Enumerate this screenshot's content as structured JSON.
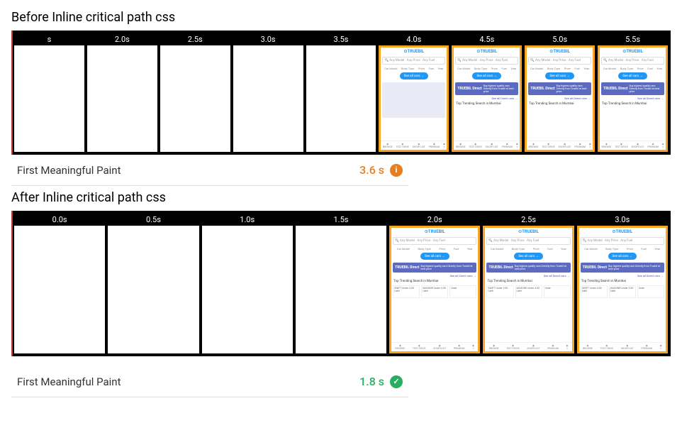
{
  "before": {
    "title": "Before Inline critical path css",
    "frames": [
      {
        "time": "s",
        "state": "blank"
      },
      {
        "time": "2.0s",
        "state": "blank"
      },
      {
        "time": "2.5s",
        "state": "blank"
      },
      {
        "time": "3.0s",
        "state": "blank"
      },
      {
        "time": "3.5s",
        "state": "blank"
      },
      {
        "time": "4.0s",
        "state": "partial"
      },
      {
        "time": "4.5s",
        "state": "loaded"
      },
      {
        "time": "5.0s",
        "state": "loaded"
      },
      {
        "time": "5.5s",
        "state": "loaded"
      }
    ],
    "metric": {
      "label": "First Meaningful Paint",
      "value": "3.6 s",
      "status": "warn"
    }
  },
  "after": {
    "title": "After Inline critical path css",
    "frames": [
      {
        "time": "0.0s",
        "state": "blank"
      },
      {
        "time": "0.5s",
        "state": "blank"
      },
      {
        "time": "1.0s",
        "state": "blank"
      },
      {
        "time": "1.5s",
        "state": "blank"
      },
      {
        "time": "2.0s",
        "state": "loaded"
      },
      {
        "time": "2.5s",
        "state": "loaded"
      },
      {
        "time": "3.0s",
        "state": "loaded"
      }
    ],
    "metric": {
      "label": "First Meaningful Paint",
      "value": "1.8 s",
      "status": "good"
    }
  },
  "mock": {
    "brand": "TRUEBIL",
    "search": "Any Model · Any Price · Any Fuel",
    "filters": [
      "Car Model",
      "Body Type",
      "Price",
      "Fuel",
      "Year"
    ],
    "cta": "See all cars →",
    "banner_logo": "TRUEBIL Direct",
    "banner_text": "Buy highest quality cars Directly from Truebil at best price",
    "banner_link": "See all Direct cars →",
    "trending": "Top Trending Search in Mumbai",
    "cards": [
      "SWIFT Under 3.00 Lakh",
      "WAGONR Under 3.00 Lakh",
      "Unde"
    ],
    "nav": [
      "BROWSE",
      "TEST DRIVE",
      "SHORTLIST",
      "PREMIUM",
      "≡"
    ]
  },
  "chart_data": {
    "type": "table",
    "title": "First Meaningful Paint before vs after inlining critical CSS",
    "series": [
      {
        "name": "Before",
        "fmp_seconds": 3.6,
        "first_loaded_frame_seconds": 4.0,
        "timeline_seconds": [
          2.0,
          2.5,
          3.0,
          3.5,
          4.0,
          4.5,
          5.0,
          5.5
        ]
      },
      {
        "name": "After",
        "fmp_seconds": 1.8,
        "first_loaded_frame_seconds": 2.0,
        "timeline_seconds": [
          0.0,
          0.5,
          1.0,
          1.5,
          2.0,
          2.5,
          3.0
        ]
      }
    ]
  }
}
